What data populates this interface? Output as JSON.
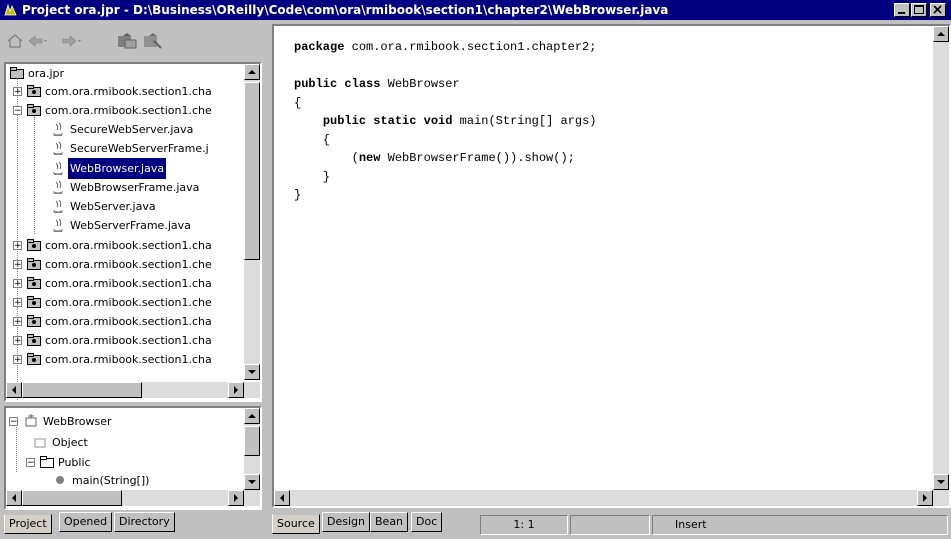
{
  "window": {
    "title": "Project ora.jpr - D:\\Business\\OReilly\\Code\\com\\ora\\rmibook\\section1\\chapter2\\WebBrowser.java"
  },
  "toolbar": {
    "icons": [
      "home-icon",
      "back-arrow-icon",
      "forward-arrow-icon",
      "add-to-project-icon",
      "remove-from-project-icon"
    ]
  },
  "tree": {
    "root": "ora.jpr",
    "packages_top": [
      "com.ora.rmibook.section1.cha",
      "com.ora.rmibook.section1.che"
    ],
    "files": [
      "SecureWebServer.java",
      "SecureWebServerFrame.j",
      "WebBrowser.java",
      "WebBrowserFrame.java",
      "WebServer.java",
      "WebServerFrame.java"
    ],
    "selected_file": "WebBrowser.java",
    "packages_bottom": [
      "com.ora.rmibook.section1.cha",
      "com.ora.rmibook.section1.che",
      "com.ora.rmibook.section1.cha",
      "com.ora.rmibook.section1.che",
      "com.ora.rmibook.section1.cha",
      "com.ora.rmibook.section1.cha",
      "com.ora.rmibook.section1.cha"
    ]
  },
  "structure": {
    "class_name": "WebBrowser",
    "parent": "Object",
    "group": "Public",
    "method": "main(String[])"
  },
  "left_tabs": [
    "Project",
    "Opened",
    "Directory"
  ],
  "editor": {
    "code_lines": [
      "package com.ora.rmibook.section1.chapter2;",
      "",
      "public class WebBrowser",
      "{",
      "    public static void main(String[] args)",
      "    {",
      "        (new WebBrowserFrame()).show();",
      "    }",
      "}"
    ]
  },
  "editor_tabs": [
    "Source",
    "Design",
    "Bean",
    "Doc"
  ],
  "status": {
    "position": "1: 1",
    "mode": "Insert"
  }
}
